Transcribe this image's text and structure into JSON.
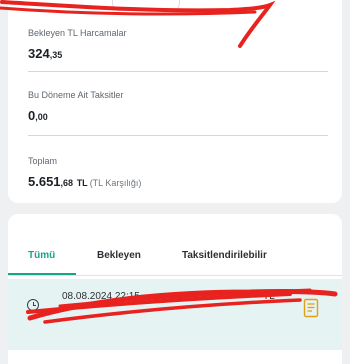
{
  "summary": {
    "pending_label": "Bekleyen TL Harcamalar",
    "pending_amount_int": "324",
    "pending_amount_dec": ",35",
    "period_label": "Bu Döneme Ait Taksitler",
    "period_amount_int": "0",
    "period_amount_dec": ",00",
    "total_label": "Toplam",
    "total_amount_int": "5.651",
    "total_amount_dec": ",68",
    "total_currency": "TL",
    "total_note": "(TL Karşılığı)"
  },
  "tabs": [
    {
      "label": "Tümü",
      "active": true
    },
    {
      "label": "Bekleyen",
      "active": false
    },
    {
      "label": "Taksitlendirilebilir",
      "active": false
    }
  ],
  "transaction": {
    "date": "08.08.2024 22:15",
    "amount": "TL"
  },
  "colors": {
    "accent": "#17a589",
    "redaction": "#e8231f",
    "row_highlight": "#e6f3f3",
    "receipt_icon": "#e0a116"
  }
}
